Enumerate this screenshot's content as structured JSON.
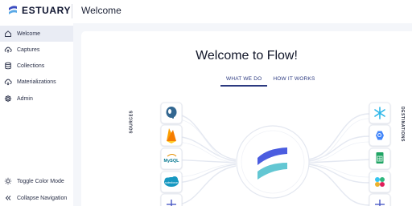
{
  "brand": {
    "name": "ESTUARY",
    "accent": "#4b5de0"
  },
  "header": {
    "title": "Welcome"
  },
  "sidebar": {
    "items": [
      {
        "label": "Welcome",
        "icon": "home-icon",
        "active": true
      },
      {
        "label": "Captures",
        "icon": "cloud-upload-icon",
        "active": false
      },
      {
        "label": "Collections",
        "icon": "database-icon",
        "active": false
      },
      {
        "label": "Materializations",
        "icon": "cloud-download-icon",
        "active": false
      },
      {
        "label": "Admin",
        "icon": "gear-icon",
        "active": false
      }
    ],
    "bottom": [
      {
        "label": "Toggle Color Mode",
        "icon": "sun-icon"
      },
      {
        "label": "Collapse Navigation",
        "icon": "double-chevron-left-icon"
      }
    ]
  },
  "main": {
    "title": "Welcome to Flow!",
    "tabs": [
      {
        "label": "WHAT WE DO",
        "active": true
      },
      {
        "label": "HOW IT WORKS",
        "active": false
      }
    ],
    "diagram": {
      "sources_label": "SOURCES",
      "destinations_label": "DESTINATIONS",
      "sources": [
        {
          "name": "postgresql-icon",
          "color": "#336791"
        },
        {
          "name": "firebase-icon",
          "color": "#f5a623"
        },
        {
          "name": "mysql-icon",
          "color": "#00758f",
          "text": "MySQL"
        },
        {
          "name": "salesforce-icon",
          "color": "#1798c1",
          "text": "salesforce"
        },
        {
          "name": "add-source-icon",
          "color": "#3b4cc0"
        }
      ],
      "destinations": [
        {
          "name": "snowflake-icon",
          "color": "#29b5e8"
        },
        {
          "name": "bigquery-icon",
          "color": "#4386fa"
        },
        {
          "name": "google-sheets-icon",
          "color": "#1fa463"
        },
        {
          "name": "slack-icon",
          "color": "#e01e5a"
        },
        {
          "name": "add-destination-icon",
          "color": "#3b4cc0"
        }
      ]
    }
  }
}
